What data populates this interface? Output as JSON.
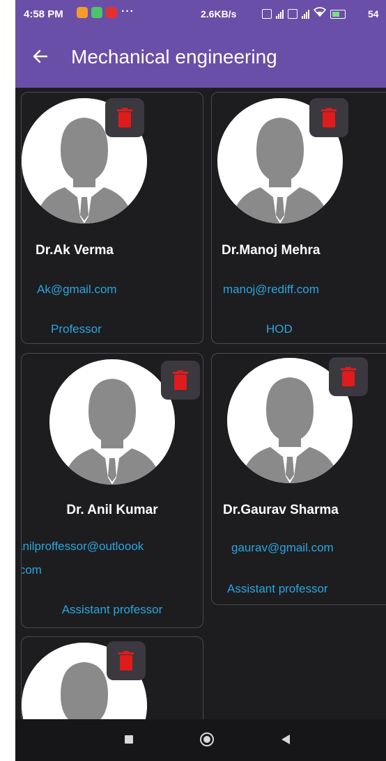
{
  "status_bar": {
    "time": "4:58 PM",
    "dots": "···",
    "net_speed": "2.6KB/s",
    "battery_pct": "54"
  },
  "app_bar": {
    "back_icon": "arrow-left-icon",
    "title": "Mechanical engineering",
    "color": "#6a4fa8"
  },
  "faculty": [
    {
      "name": "Dr.Ak Verma",
      "email": "Ak@gmail.com",
      "role": "Professor"
    },
    {
      "name": "Dr.Manoj Mehra",
      "email": "manoj@rediff.com",
      "role": "HOD"
    },
    {
      "name": "Dr. Anil Kumar",
      "email_line1": "anilproffessor@outloook",
      "email_line2": ".com",
      "role": "Assistant professor"
    },
    {
      "name": "Dr.Gaurav Sharma",
      "email": "gaurav@gmail.com",
      "role": "Assistant professor"
    },
    {
      "name": "",
      "email": "",
      "role": ""
    }
  ],
  "colors": {
    "background": "#1d1d20",
    "link": "#2aa6df",
    "delete": "#e01b1b"
  },
  "nav_icons": [
    "recent-apps-icon",
    "home-icon",
    "back-triangle-icon"
  ]
}
